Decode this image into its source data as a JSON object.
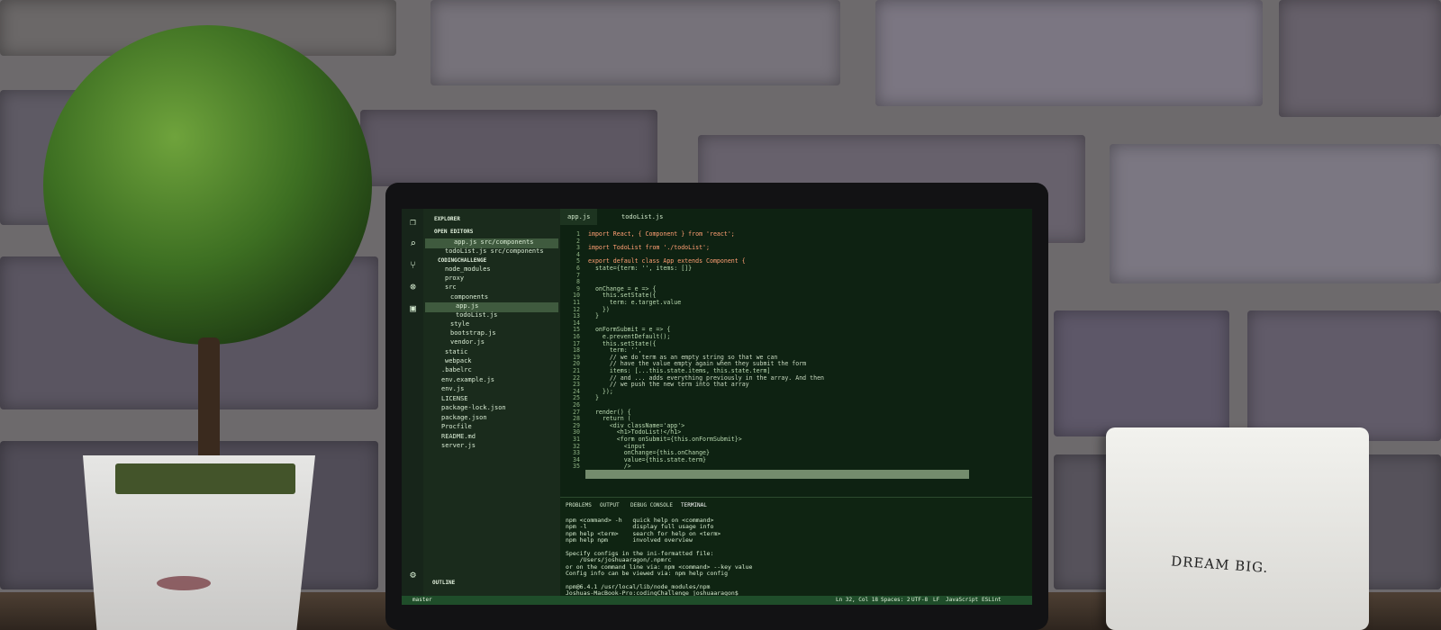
{
  "editor": {
    "tabs": [
      "app.js",
      "todoList.js"
    ],
    "explorer_title": "EXPLORER",
    "open_editors": "OPEN EDITORS",
    "open_files": [
      "app.js  src/components",
      "todoList.js  src/components"
    ],
    "project": "CODINGCHALLENGE",
    "tree": [
      "node_modules",
      "proxy",
      "src",
      "components",
      "app.js",
      "todoList.js",
      "style",
      "bootstrap.js",
      "vendor.js",
      "static",
      "webpack",
      ".babelrc",
      "env.example.js",
      "env.js",
      "LICENSE",
      "package-lock.json",
      "package.json",
      "Procfile",
      "README.md",
      "server.js"
    ],
    "outline": "OUTLINE",
    "code": [
      {
        "n": "1",
        "t": "import React, { Component } from 'react';"
      },
      {
        "n": "2",
        "t": ""
      },
      {
        "n": "3",
        "t": "import TodoList from './todoList';"
      },
      {
        "n": "4",
        "t": ""
      },
      {
        "n": "5",
        "t": "export default class App extends Component {"
      },
      {
        "n": "6",
        "t": "  state={term: '', items: []}"
      },
      {
        "n": "7",
        "t": ""
      },
      {
        "n": "8",
        "t": ""
      },
      {
        "n": "9",
        "t": "  onChange = e => {"
      },
      {
        "n": "10",
        "t": "    this.setState({"
      },
      {
        "n": "11",
        "t": "      term: e.target.value"
      },
      {
        "n": "12",
        "t": "    })"
      },
      {
        "n": "13",
        "t": "  }"
      },
      {
        "n": "14",
        "t": ""
      },
      {
        "n": "15",
        "t": "  onFormSubmit = e => {"
      },
      {
        "n": "16",
        "t": "    e.preventDefault();"
      },
      {
        "n": "17",
        "t": "    this.setState({"
      },
      {
        "n": "18",
        "t": "      term: '',"
      },
      {
        "n": "19",
        "t": "      // we do term as an empty string so that we can"
      },
      {
        "n": "20",
        "t": "      // have the value empty again when they submit the form"
      },
      {
        "n": "21",
        "t": "      items: [...this.state.items, this.state.term]"
      },
      {
        "n": "22",
        "t": "      // and ... adds everything previously in the array. And then"
      },
      {
        "n": "23",
        "t": "      // we push the new term into that array"
      },
      {
        "n": "24",
        "t": "    });"
      },
      {
        "n": "25",
        "t": "  }"
      },
      {
        "n": "26",
        "t": ""
      },
      {
        "n": "27",
        "t": "  render() {"
      },
      {
        "n": "28",
        "t": "    return ("
      },
      {
        "n": "29",
        "t": "      <div className='app'>"
      },
      {
        "n": "30",
        "t": "        <h1>TodoList!</h1>"
      },
      {
        "n": "31",
        "t": "        <form onSubmit={this.onFormSubmit}>"
      },
      {
        "n": "32",
        "t": "          <input"
      },
      {
        "n": "33",
        "t": "          onChange={this.onChange}"
      },
      {
        "n": "34",
        "t": "          value={this.state.term}"
      },
      {
        "n": "35",
        "t": "          />"
      }
    ],
    "panel_tabs": [
      "PROBLEMS",
      "OUTPUT",
      "DEBUG CONSOLE",
      "TERMINAL"
    ],
    "terminal": [
      "npm <command> -h   quick help on <command>",
      "npm -l             display full usage info",
      "npm help <term>    search for help on <term>",
      "npm help npm       involved overview",
      "",
      "Specify configs in the ini-formatted file:",
      "    /Users/joshuaaragon/.npmrc",
      "or on the command line via: npm <command> --key value",
      "Config info can be viewed via: npm help config",
      "",
      "npm@6.4.1 /usr/local/lib/node_modules/npm",
      "Joshuas-MacBook-Pro:codingChallenge joshuaaragon$"
    ],
    "status": {
      "branch": "master",
      "position": "Ln 32, Col 18",
      "spaces": "Spaces: 2",
      "encoding": "UTF-8",
      "eol": "LF",
      "language": "JavaScript",
      "linter": "ESLint"
    }
  },
  "box_text": "DREAM BIG."
}
